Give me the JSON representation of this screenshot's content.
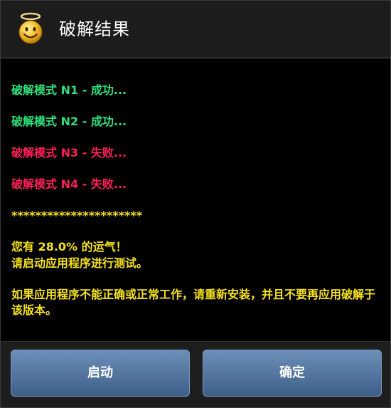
{
  "dialog": {
    "title": "破解结果",
    "icon": "angel-smiley-icon"
  },
  "results": [
    {
      "text": "破解模式 N1 - 成功...",
      "status": "success"
    },
    {
      "text": "破解模式 N2 - 成功...",
      "status": "success"
    },
    {
      "text": "破解模式 N3 - 失败...",
      "status": "failure"
    },
    {
      "text": "破解模式 N4 - 失败...",
      "status": "failure"
    }
  ],
  "separator": "**********************",
  "luck_line": "您有 28.0% 的运气！",
  "instruction_line": "请启动应用程序进行测试。",
  "warning_text": "如果应用程序不能正确或正常工作，请重新安装，并且不要再应用破解于该版本。",
  "buttons": {
    "launch_label": "启动",
    "confirm_label": "确定"
  },
  "colors": {
    "success": "#2fe07a",
    "failure": "#ff1f56",
    "info": "#f5e11e",
    "button": "#5377a3"
  }
}
